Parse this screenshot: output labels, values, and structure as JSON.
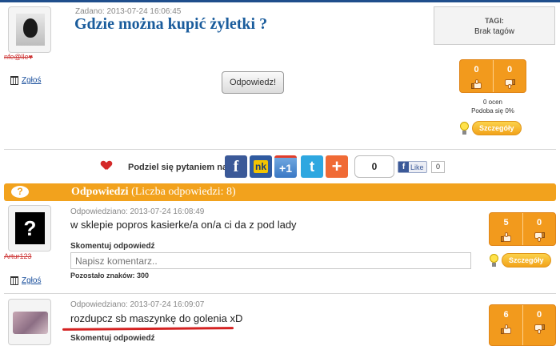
{
  "question": {
    "asked_label": "Zadano: 2013-07-24 16:06:45",
    "title": "Gdzie można kupić żyletki ?",
    "username": "nfe@lle♥",
    "report_label": "Zgłoś",
    "answer_button": "Odpowiedz!",
    "tags": {
      "title": "TAGI:",
      "value": "Brak tagów"
    },
    "votes": {
      "up": 0,
      "down": 0
    },
    "ratings_count": "0 ocen",
    "likes_percent": "Podoba się 0%",
    "details_button": "Szczegóły"
  },
  "share": {
    "label": "Podziel się pytaniem na:",
    "icons": [
      "facebook-icon",
      "nk-icon",
      "google-plus-icon",
      "twitter-icon",
      "add-icon"
    ],
    "icon_text": {
      "facebook": "f",
      "nk": "nk",
      "gplus": "+1",
      "twitter": "t",
      "add": "+"
    },
    "count": "0",
    "fb_like": "Like",
    "fb_count": "0"
  },
  "answers_header": {
    "icon": "?",
    "title": "Odpowiedzi",
    "count_text": "(Liczba odpowiedzi: 8)"
  },
  "answers": [
    {
      "meta": "Odpowiedziano: 2013-07-24 16:08:49",
      "text": "w sklepie popros kasierke/a on/a ci da z pod lady",
      "username": "Artur123",
      "avatar_symbol": "?",
      "comment_label": "Skomentuj odpowiedź",
      "comment_placeholder": "Napisz komentarz..",
      "remaining": "Pozostało znaków: 300",
      "report_label": "Zgłoś",
      "votes": {
        "up": 5,
        "down": 0
      },
      "details_button": "Szczegóły"
    },
    {
      "meta": "Odpowiedziano: 2013-07-24 16:09:07",
      "text": "rozdupcz sb maszynkę do golenia xD",
      "comment_label": "Skomentuj odpowiedź",
      "votes": {
        "up": 6,
        "down": 0
      }
    }
  ],
  "colors": {
    "accent_orange": "#f2a21d",
    "title_blue": "#1a5c9c",
    "link_blue": "#1a4f9c"
  }
}
